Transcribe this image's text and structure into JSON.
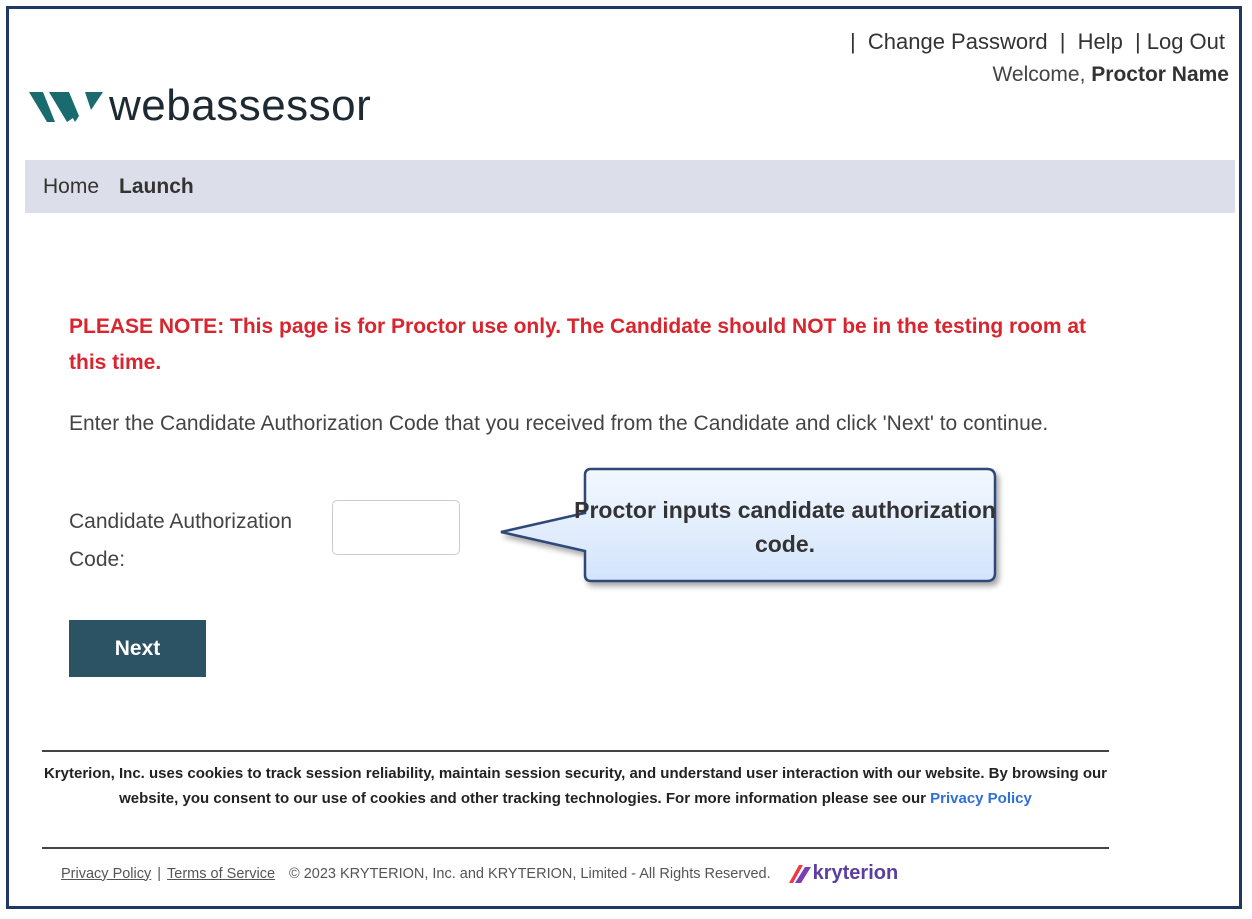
{
  "header": {
    "links": [
      "Change Password",
      "Help",
      "Log Out"
    ],
    "welcome_prefix": "Welcome,",
    "user_name": "Proctor Name",
    "logo_text": "webassessor"
  },
  "nav": {
    "items": [
      "Home",
      "Launch"
    ]
  },
  "main": {
    "note": "PLEASE NOTE: This page is for Proctor use only. The Candidate should NOT be in the testing room at this time.",
    "instructions": "Enter the Candidate Authorization Code that you received from the Candidate and click 'Next' to continue.",
    "code_label": "Candidate Authorization Code:",
    "code_value": "",
    "next_label": "Next",
    "callout": "Proctor inputs candidate authorization code."
  },
  "footer": {
    "cookie_text": "Kryterion, Inc. uses cookies to track session reliability, maintain session security, and understand user interaction with our website. By browsing our website, you consent to our use of cookies and other tracking technologies. For more information please see our",
    "cookie_link": "Privacy Policy",
    "privacy_link": "Privacy Policy",
    "terms_link": "Terms of Service",
    "copyright": "© 2023  KRYTERION, Inc. and KRYTERION, Limited - All Rights Reserved.",
    "brand": "kryterion"
  },
  "colors": {
    "frame_border": "#1f3864",
    "nav_bg": "#dcdee9",
    "note_red": "#d8252e",
    "button_bg": "#2c5364",
    "callout_fill": "#e3efff",
    "callout_border": "#2f4a78",
    "link_blue": "#2f6fd6",
    "brand_purple": "#5b3fa0"
  },
  "icons": [
    "webassessor-logo-icon",
    "kryterion-logo-icon"
  ]
}
